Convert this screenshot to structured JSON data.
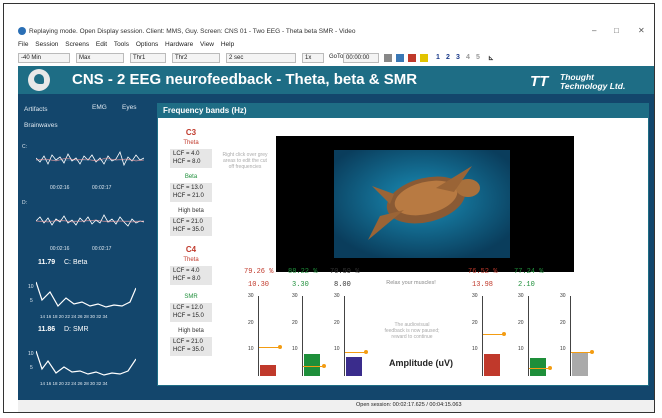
{
  "window": {
    "title": "Replaying mode. Open Display session. Client: MMS, Guy. Screen: CNS 01 - Two EEG - Theta beta SMR - Video",
    "minimize": "–",
    "maximize": "□",
    "close": "✕"
  },
  "menu": [
    "File",
    "Session",
    "Screens",
    "Edit",
    "Tools",
    "Options",
    "Hardware",
    "View",
    "Help"
  ],
  "toolbar": {
    "dd1": "-40 Min",
    "dd2": "Max",
    "dd3": "Thr1",
    "dd4": "Thr2",
    "dd5": "2 sec",
    "dd6": "1x",
    "goto_label": "GoTo",
    "goto_value": "00:00:00",
    "screens": [
      "1",
      "2",
      "3",
      "4",
      "5"
    ]
  },
  "header": {
    "title": "CNS - 2 EEG neurofeedback - Theta, beta & SMR",
    "brand_line1": "Thought",
    "brand_line2": "Technology Ltd."
  },
  "sidebar": {
    "artifacts": "Artifacts",
    "emg": "EMG",
    "eyes": "Eyes",
    "brainwaves": "Brainwaves",
    "c_label": "C:",
    "d_label": "D:",
    "t1": "00:02:16",
    "t2": "00:02:17",
    "t3": "00:02:16",
    "t4": "00:02:17",
    "beta_value": "11.79",
    "beta_label": "C: Beta",
    "smr_value": "11.86",
    "smr_label": "D: SMR",
    "yticks": [
      "10",
      "5"
    ],
    "xticks": "14 16 18 20 22 24 26 28 30 32 34"
  },
  "panel": {
    "title": "Frequency bands (Hz)",
    "c3": "C3",
    "c4": "C4",
    "theta": "Theta",
    "beta": "Beta",
    "high_beta": "High beta",
    "smr": "SMR",
    "c3_theta": "LCF = 4.0\nHCF = 8.0",
    "c3_beta": "LCF = 13.0\nHCF = 21.0",
    "c3_hbeta": "LCF = 21.0\nHCF = 35.0",
    "c4_theta": "LCF = 4.0\nHCF = 8.0",
    "c4_smr": "LCF = 12.0\nHCF = 15.0",
    "c4_hbeta": "LCF = 21.0\nHCF = 35.0",
    "hint1": "Right click over grey areas to edit the cut off frequencies",
    "hint2": "Relax your muscles!",
    "hint3": "The audiovisual feedback is now paused; reward to continue",
    "amplitude": "Amplitude (uV)",
    "yticks": [
      "30",
      "20",
      "10"
    ]
  },
  "bars": [
    {
      "pct": "79.26 %",
      "val": "10.30",
      "color": "#c0392b",
      "level": 0.14,
      "thr": 0.36,
      "pct_color": "#c0392b"
    },
    {
      "pct": "88.22 %",
      "val": "3.30",
      "color": "#1e8f3a",
      "level": 0.27,
      "thr": 0.12,
      "pct_color": "#1e8f3a"
    },
    {
      "pct": "70.59 %",
      "val": "8.00",
      "color": "#3a2c8c",
      "level": 0.24,
      "thr": 0.3,
      "pct_color": "#333333"
    },
    {
      "pct": "76.52 %",
      "val": "13.98",
      "color": "#c0392b",
      "level": 0.28,
      "thr": 0.52,
      "pct_color": "#c0392b"
    },
    {
      "pct": "77.24 %",
      "val": "2.10",
      "color": "#1e8f3a",
      "level": 0.22,
      "thr": 0.1,
      "pct_color": "#1e8f3a"
    },
    {
      "pct": "",
      "val": "",
      "color": "#aaaaaa",
      "level": 0.3,
      "thr": 0.3,
      "pct_color": "#aaaaaa"
    }
  ],
  "status": "Open session: 00:02:17.625 / 00:04:15.063"
}
